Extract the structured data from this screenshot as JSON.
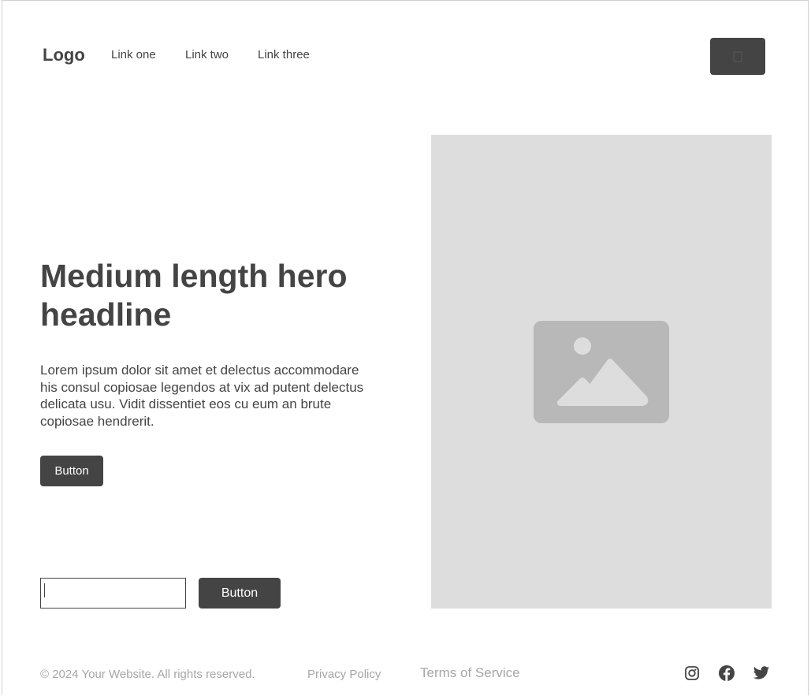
{
  "header": {
    "logo": "Logo",
    "nav": [
      {
        "label": "Link one"
      },
      {
        "label": "Link two"
      },
      {
        "label": "Link three"
      }
    ],
    "menu_button_icon": "menu-icon"
  },
  "hero": {
    "headline": "Medium length hero headline",
    "body": "Lorem ipsum dolor sit amet et delectus accommodare his consul copiosae legendos at vix ad putent delectus delicata usu. Vidit dissentiet eos cu eum an brute copiosae hendrerit.",
    "primary_button": "Button",
    "email_input": {
      "value": "",
      "placeholder": ""
    },
    "submit_button": "Button",
    "image_icon": "image-placeholder-icon"
  },
  "footer": {
    "copyright": "© 2024 Your Website. All rights reserved.",
    "links": [
      {
        "label": "Privacy Policy"
      },
      {
        "label": "Terms of Service"
      }
    ],
    "social": [
      {
        "icon": "instagram-icon"
      },
      {
        "icon": "facebook-icon"
      },
      {
        "icon": "twitter-icon"
      }
    ]
  },
  "colors": {
    "primary": "#444444",
    "placeholder_bg": "#dddddd",
    "placeholder_icon": "#b8b8b8",
    "muted_text": "#a6a6a6"
  }
}
